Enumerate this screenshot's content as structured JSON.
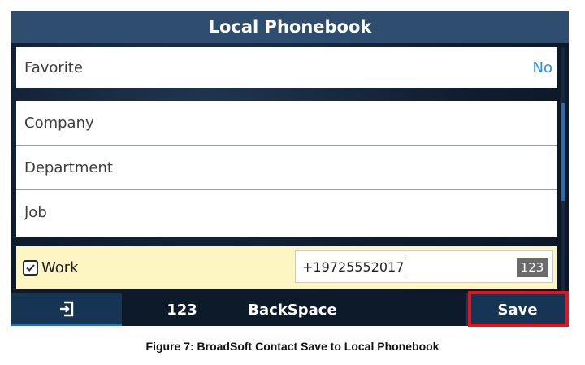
{
  "window": {
    "title": "Local Phonebook"
  },
  "favorite": {
    "label": "Favorite",
    "value": "No"
  },
  "fields": [
    {
      "label": "Company"
    },
    {
      "label": "Department"
    },
    {
      "label": "Job"
    }
  ],
  "work": {
    "label": "Work",
    "checked": true,
    "value": "+19725552017",
    "input_mode": "123"
  },
  "softkeys": {
    "back_icon": "exit-icon",
    "mode": "123",
    "backspace": "BackSpace",
    "save": "Save"
  },
  "caption": "Figure 7: BroadSoft Contact Save to Local Phonebook",
  "colors": {
    "title_bar": "#2e4d6f",
    "accent_blue": "#2a8fd6",
    "work_row": "#fdf6c2",
    "highlight_red": "#e3141e"
  }
}
